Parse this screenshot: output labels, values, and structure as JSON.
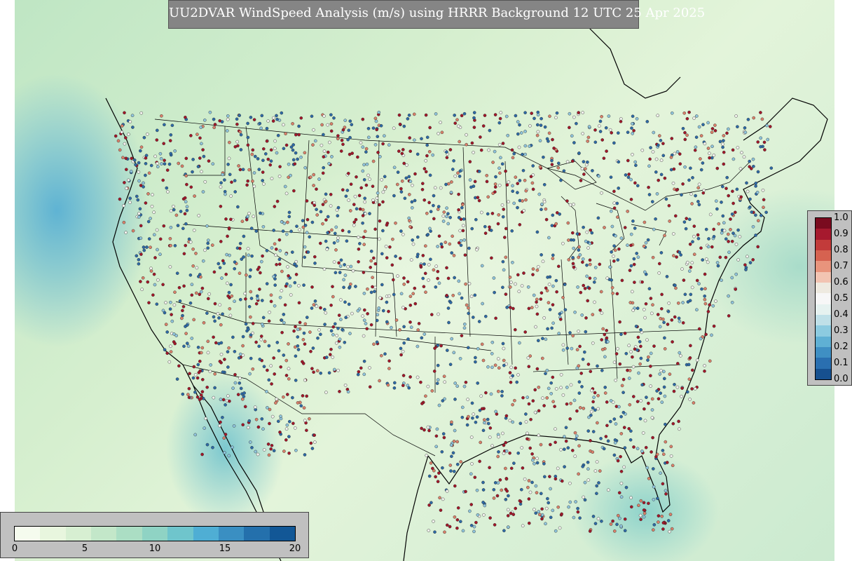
{
  "title": "UU2DVAR WindSpeed Analysis (m/s) using HRRR Background 12 UTC 25 Apr 2025",
  "correlation_colorbar": {
    "ticks": [
      "1.0",
      "0.9",
      "0.8",
      "0.7",
      "0.6",
      "0.5",
      "0.4",
      "0.3",
      "0.2",
      "0.1",
      "0.0"
    ],
    "colors_top_to_bottom": [
      "#7a0b1f",
      "#a6192e",
      "#c23b3a",
      "#d66250",
      "#e8947c",
      "#f2c4b2",
      "#eeeae0",
      "#f7f7f7",
      "#e6f2f0",
      "#bfe0e8",
      "#8ccbe0",
      "#5fb0d4",
      "#3f8fc3",
      "#2a6fb0",
      "#16508f"
    ]
  },
  "windspeed_colorbar": {
    "ticks": [
      "0",
      "5",
      "10",
      "15",
      "20"
    ],
    "colors_left_to_right": [
      "#f5fbee",
      "#e8f6de",
      "#d7efd2",
      "#c3e7c9",
      "#abdec4",
      "#8fd3c4",
      "#6fc5cc",
      "#4faed4",
      "#3a8fc2",
      "#2470ac",
      "#125796"
    ]
  },
  "marker_colors": {
    "high": "#a1182a",
    "mid_high": "#d9806a",
    "neutral": "#f2f2ee",
    "mid_low": "#8fc4dc",
    "low": "#2e6aa6"
  }
}
